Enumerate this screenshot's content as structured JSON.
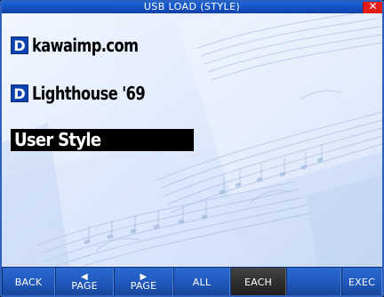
{
  "window": {
    "title": "USB LOAD (STYLE)"
  },
  "list": {
    "items": [
      {
        "badge": "D",
        "label": "kawaimp.com"
      },
      {
        "badge": "D",
        "label": "Lighthouse '69"
      },
      {
        "label": "User Style"
      }
    ]
  },
  "footer": {
    "buttons": [
      {
        "label": "BACK"
      },
      {
        "label": "PAGE"
      },
      {
        "label": "PAGE"
      },
      {
        "label": "ALL"
      },
      {
        "label": "EACH"
      },
      {
        "label": ""
      },
      {
        "label": "EXEC"
      }
    ]
  },
  "icons": {
    "close": "close-icon",
    "page_prev": "left-arrow-icon",
    "page_next": "right-arrow-icon"
  },
  "colors": {
    "titlebar": "#1757c8",
    "close": "#e31d18",
    "selected_bg": "#000000",
    "file_badge": "#0d43b0",
    "footer": "#1a54b6",
    "active_button": "#2c2c2c"
  }
}
